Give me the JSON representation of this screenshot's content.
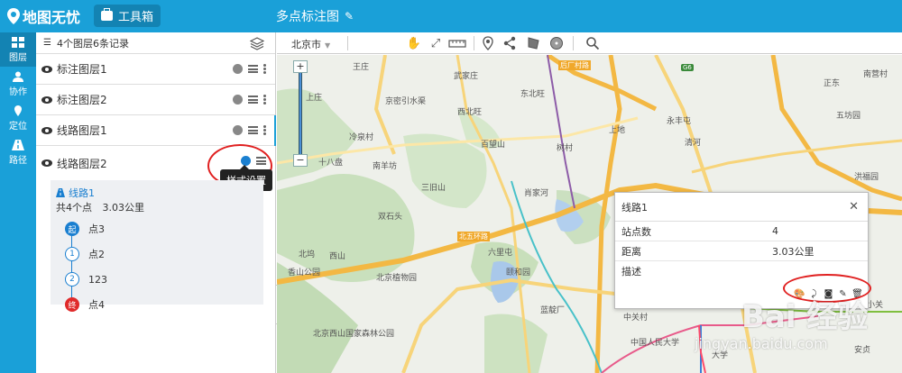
{
  "header": {
    "app_name": "地图无忧",
    "toolbox_label": "工具箱",
    "document_title": "多点标注图"
  },
  "nav": {
    "items": [
      {
        "label": "图层",
        "icon": "layers-icon",
        "active": true
      },
      {
        "label": "协作",
        "icon": "users-icon",
        "active": false
      },
      {
        "label": "定位",
        "icon": "locate-icon",
        "active": false
      },
      {
        "label": "路径",
        "icon": "route-icon",
        "active": false
      }
    ]
  },
  "panel": {
    "summary": "4个图层6条记录",
    "layers": [
      "标注图层1",
      "标注图层2",
      "线路图层1",
      "线路图层2"
    ],
    "tooltip": "样式设置",
    "route": {
      "name": "线路1",
      "point_count": "共4个点",
      "distance": "3.03公里",
      "points": [
        {
          "marker": "起",
          "name": "点3"
        },
        {
          "marker": "1",
          "name": "点2"
        },
        {
          "marker": "2",
          "name": "123"
        },
        {
          "marker": "终",
          "name": "点4"
        }
      ]
    }
  },
  "map_toolbar": {
    "city": "北京市",
    "tools": [
      "pan-hand-icon",
      "fullscreen-icon",
      "ruler-icon",
      "marker-icon",
      "share-icon",
      "polygon-icon",
      "circle-icon",
      "search-icon"
    ]
  },
  "map": {
    "zoom_in": "+",
    "zoom_out": "−",
    "places": [
      "王庄",
      "武家庄",
      "后厂村路",
      "G6",
      "上庄",
      "东北旺",
      "西北旺",
      "京密引水渠",
      "永丰屯",
      "冷泉村",
      "百望山",
      "树村",
      "上地",
      "清河",
      "南羊坊",
      "三旧山",
      "肖家河",
      "十八盘",
      "双石头",
      "北坞",
      "香山公园",
      "颐和园",
      "六里屯",
      "北京植物园",
      "西山",
      "蓝靛厂",
      "北京西山国家森林公园",
      "中关村",
      "中国人民大学",
      "安贞",
      "大学",
      "五坊园",
      "小关",
      "正东",
      "洪福园",
      "南营村",
      "北五环路"
    ]
  },
  "popup": {
    "title": "线路1",
    "rows": [
      {
        "label": "站点数",
        "value": "4"
      },
      {
        "label": "距离",
        "value": "3.03公里"
      },
      {
        "label": "描述",
        "value": ""
      }
    ],
    "icons": [
      "palette-icon",
      "path-icon",
      "camera-icon",
      "edit-icon",
      "trash-icon"
    ]
  },
  "watermark": {
    "main": "Bai 经验",
    "sub": "jingyan.baidu.com"
  },
  "colors": {
    "primary": "#1aa0d8",
    "primary_dark": "#1383b3",
    "highlight_ring": "#e02020",
    "route_blue": "#1a7fd0"
  }
}
